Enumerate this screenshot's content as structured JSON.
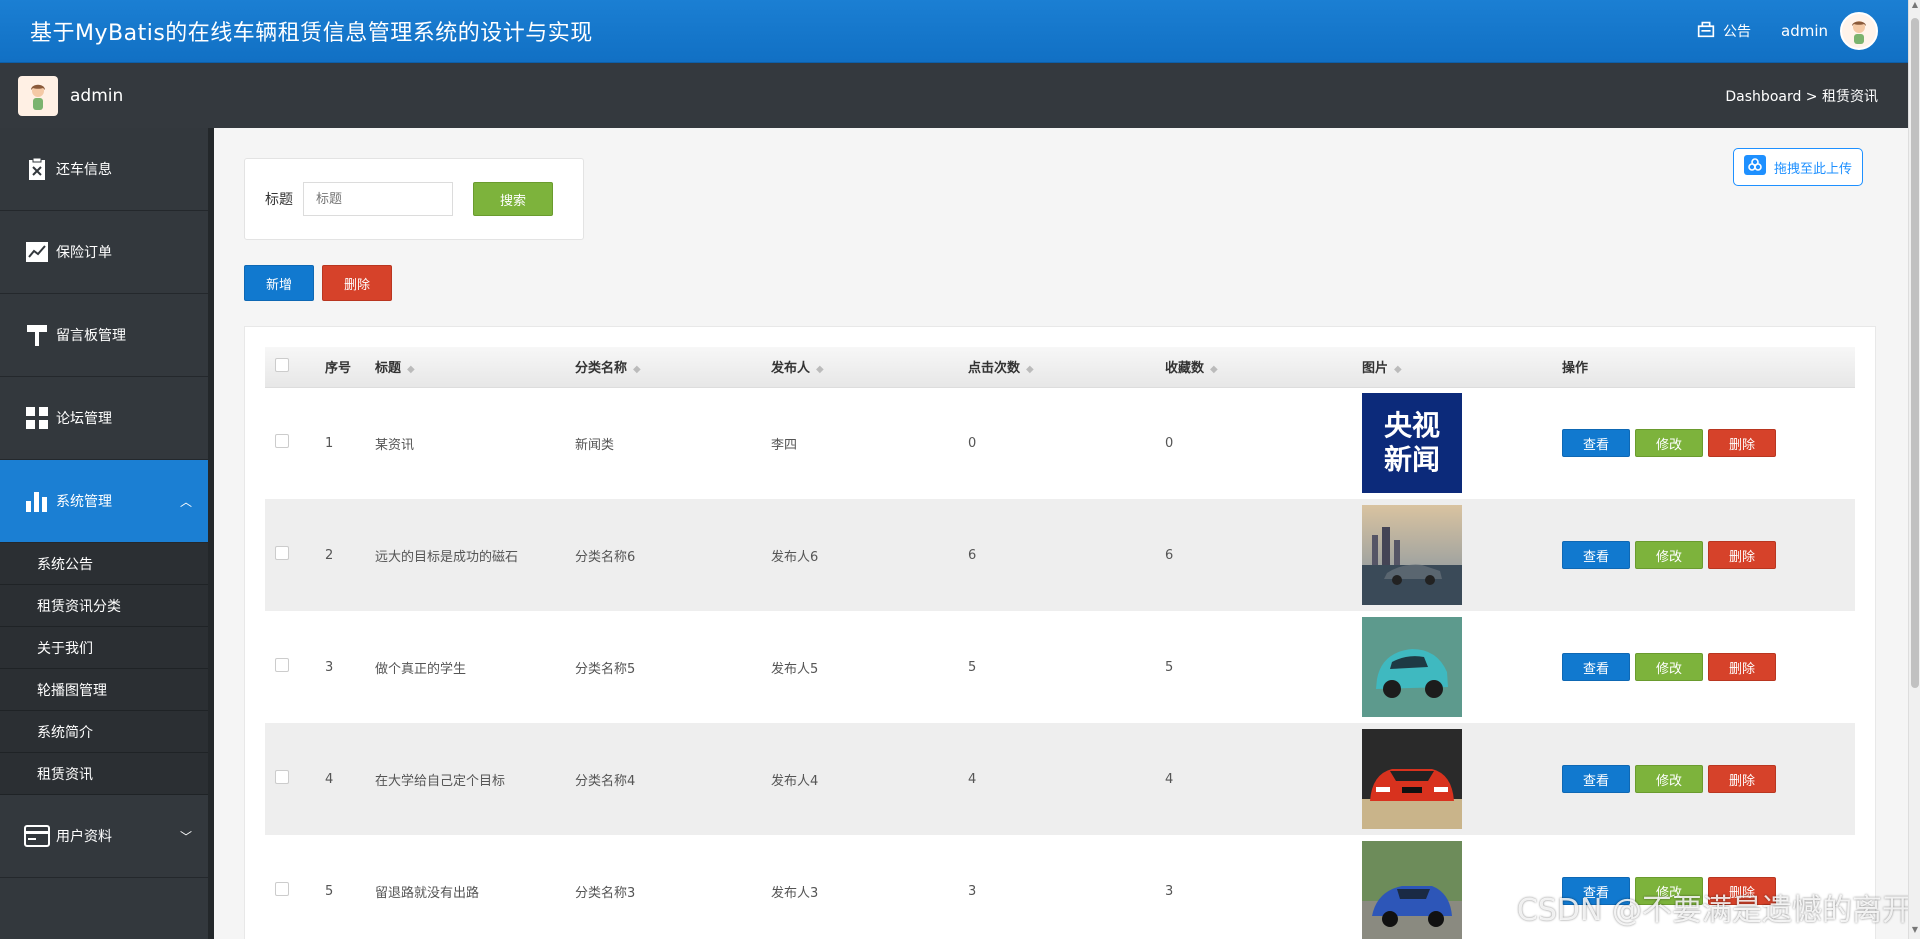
{
  "header": {
    "title": "基于MyBatis的在线车辆租赁信息管理系统的设计与实现",
    "notice_label": "公告",
    "user": "admin"
  },
  "subbar": {
    "user": "admin",
    "breadcrumb": "Dashboard > 租赁资讯"
  },
  "sidebar": {
    "items": [
      {
        "label": "还车信息",
        "icon": "clipboard-x-icon"
      },
      {
        "label": "保险订单",
        "icon": "chart-line-icon"
      },
      {
        "label": "留言板管理",
        "icon": "paint-roller-icon"
      },
      {
        "label": "论坛管理",
        "icon": "grid-icon"
      },
      {
        "label": "系统管理",
        "icon": "bar-chart-icon",
        "active": true,
        "expanded": true
      },
      {
        "label": "用户资料",
        "icon": "id-card-icon"
      }
    ],
    "submenu": [
      "系统公告",
      "租赁资讯分类",
      "关于我们",
      "轮播图管理",
      "系统简介",
      "租赁资讯"
    ]
  },
  "search": {
    "label": "标题",
    "placeholder": "标题",
    "button": "搜索"
  },
  "upload_label": "拖拽至此上传",
  "toolbar": {
    "add": "新增",
    "delete": "删除"
  },
  "table": {
    "columns": [
      "序号",
      "标题",
      "分类名称",
      "发布人",
      "点击次数",
      "收藏数",
      "图片",
      "操作"
    ],
    "rows": [
      {
        "no": "1",
        "title": "某资讯",
        "category": "新闻类",
        "author": "李四",
        "clicks": "0",
        "favs": "0",
        "image": "cctv-news-logo"
      },
      {
        "no": "2",
        "title": "远大的目标是成功的磁石",
        "category": "分类名称6",
        "author": "发布人6",
        "clicks": "6",
        "favs": "6",
        "image": "gray-sedan-city"
      },
      {
        "no": "3",
        "title": "做个真正的学生",
        "category": "分类名称5",
        "author": "发布人5",
        "clicks": "5",
        "favs": "5",
        "image": "teal-compact-car"
      },
      {
        "no": "4",
        "title": "在大学给自己定个目标",
        "category": "分类名称4",
        "author": "发布人4",
        "clicks": "4",
        "favs": "4",
        "image": "red-sports-car"
      },
      {
        "no": "5",
        "title": "留退路就没有出路",
        "category": "分类名称3",
        "author": "发布人3",
        "clicks": "3",
        "favs": "3",
        "image": "blue-sedan"
      }
    ],
    "ops": {
      "view": "查看",
      "edit": "修改",
      "delete": "删除"
    },
    "cctv_logo_text": [
      "央视",
      "新闻"
    ]
  },
  "watermark": "CSDN @不要满是遗憾的离开",
  "colors": {
    "header_blue": "#1b7fd3",
    "dark_bar": "#34393e",
    "green": "#7db33c",
    "red": "#d6422a",
    "blue": "#1179cf"
  }
}
